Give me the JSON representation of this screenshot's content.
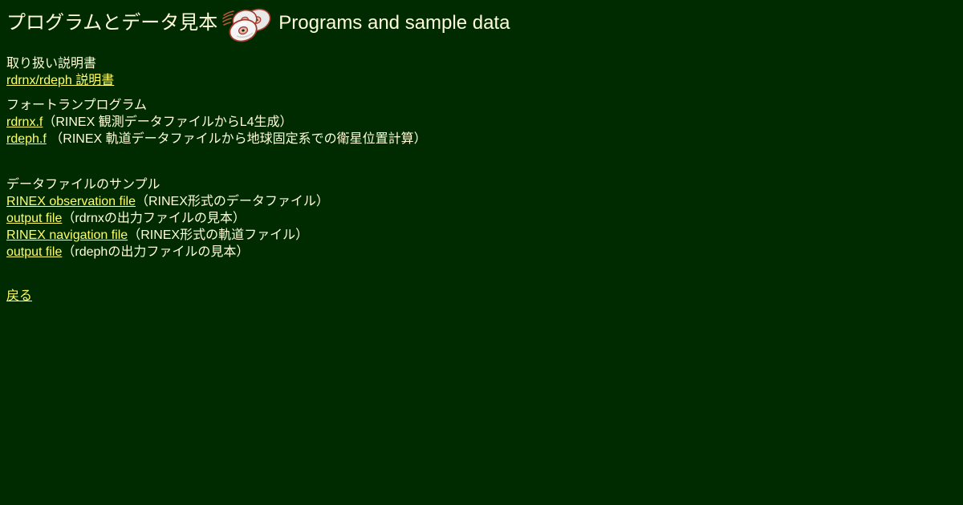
{
  "title": {
    "jp": "プログラムとデータ見本",
    "en": "Programs and sample data",
    "icon": "cd-discs-icon"
  },
  "manual": {
    "heading": "取り扱い説明書",
    "link": "rdrnx/rdeph 説明書"
  },
  "fortran": {
    "heading": "フォートランプログラム",
    "items": [
      {
        "link": "rdrnx.f",
        "note": "（RINEX 観測データファイルからL4生成）"
      },
      {
        "link": "rdeph.f",
        "note": " （RINEX 軌道データファイルから地球固定系での衛星位置計算）"
      }
    ]
  },
  "samples": {
    "heading": "データファイルのサンプル",
    "items": [
      {
        "link": "RINEX observation file",
        "note": "（RINEX形式のデータファイル）"
      },
      {
        "link": "output file",
        "note": "（rdrnxの出力ファイルの見本）"
      },
      {
        "link": "RINEX navigation file",
        "note": "（RINEX形式の軌道ファイル）"
      },
      {
        "link": "output file",
        "note": "（rdephの出力ファイルの見本）"
      }
    ]
  },
  "back": {
    "link": "戻る"
  },
  "colors": {
    "background": "#002a00",
    "text": "#fffdd8",
    "link": "#ffff66"
  }
}
